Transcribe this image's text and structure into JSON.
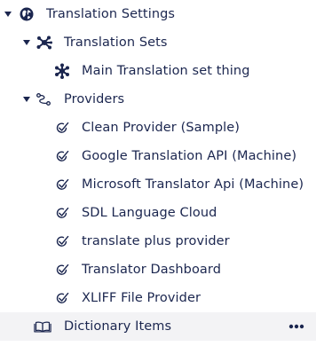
{
  "tree": {
    "root": {
      "label": "Translation Settings",
      "icon": "globe-icon",
      "expanded": true
    },
    "translation_sets": {
      "label": "Translation Sets",
      "icon": "network-icon",
      "expanded": true,
      "items": [
        {
          "label": "Main Translation set thing",
          "icon": "network-icon"
        }
      ]
    },
    "providers": {
      "label": "Providers",
      "icon": "path-icon",
      "expanded": true,
      "items": [
        {
          "label": "Clean Provider (Sample)",
          "icon": "check-icon"
        },
        {
          "label": "Google Translation API (Machine)",
          "icon": "check-icon"
        },
        {
          "label": "Microsoft Translator Api (Machine)",
          "icon": "check-icon"
        },
        {
          "label": "SDL Language Cloud",
          "icon": "check-icon"
        },
        {
          "label": "translate plus provider",
          "icon": "check-icon"
        },
        {
          "label": "Translator Dashboard",
          "icon": "check-icon"
        },
        {
          "label": "XLIFF File Provider",
          "icon": "check-icon"
        }
      ]
    },
    "dictionary": {
      "label": "Dictionary Items",
      "icon": "book-icon",
      "actions_icon": "more-icon"
    }
  },
  "colors": {
    "text": "#1b264f",
    "hover_bg": "#f3f3f5"
  }
}
